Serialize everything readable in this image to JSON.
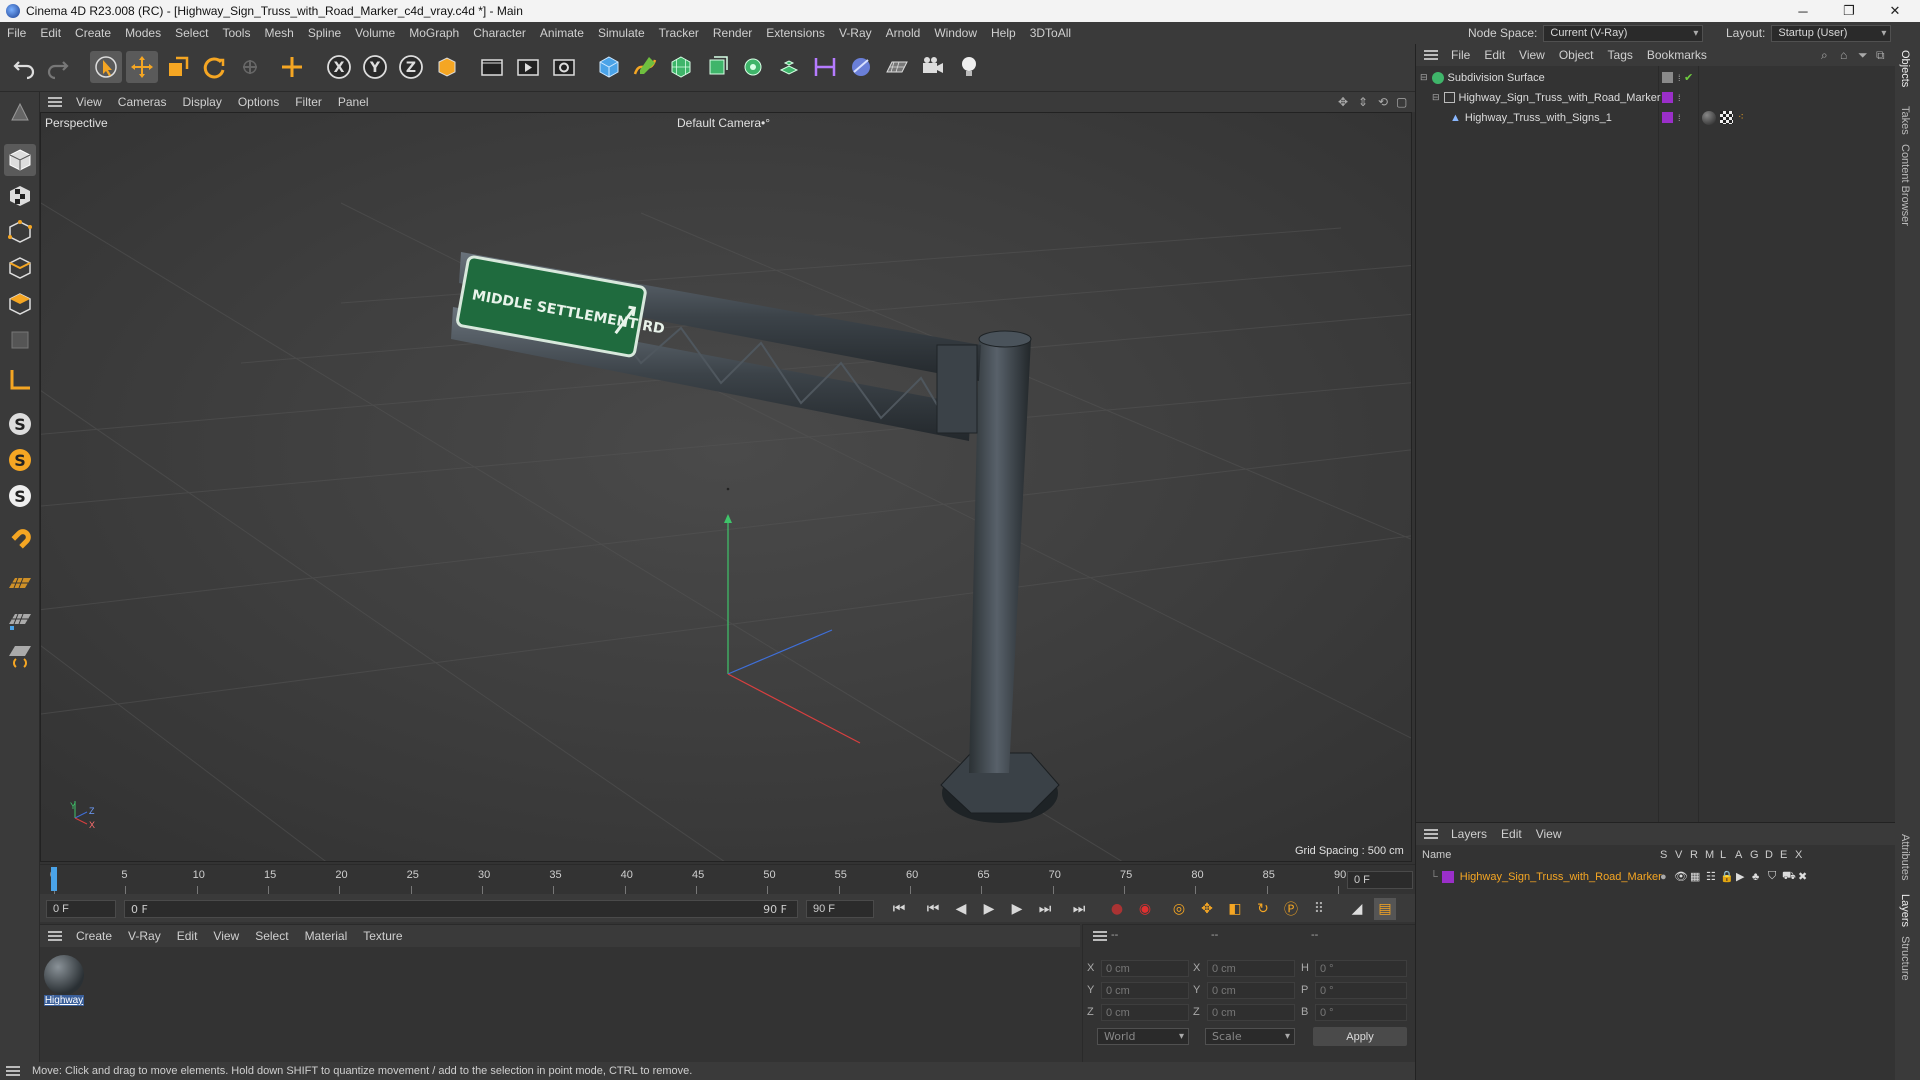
{
  "window": {
    "title": "Cinema 4D R23.008 (RC) - [Highway_Sign_Truss_with_Road_Marker_c4d_vray.c4d *] - Main",
    "minimize": "─",
    "maximize": "❐",
    "close": "✕"
  },
  "menubar": {
    "items": [
      "File",
      "Edit",
      "Create",
      "Modes",
      "Select",
      "Tools",
      "Mesh",
      "Spline",
      "Volume",
      "MoGraph",
      "Character",
      "Animate",
      "Simulate",
      "Tracker",
      "Render",
      "Extensions",
      "V-Ray",
      "Arnold",
      "Window",
      "Help",
      "3DToAll"
    ],
    "node_space_label": "Node Space:",
    "node_space_value": "Current (V-Ray)",
    "layout_label": "Layout:",
    "layout_value": "Startup (User)"
  },
  "viewport": {
    "menu": [
      "View",
      "Cameras",
      "Display",
      "Options",
      "Filter",
      "Panel"
    ],
    "view_name": "Perspective",
    "camera": "Default Camera",
    "camera_suffix": "•°",
    "grid_spacing": "Grid Spacing : 500 cm",
    "sign_text": "MIDDLE SETTLEMENT RD",
    "axis_y": "Y",
    "axis_z": "Z",
    "axis_x": "X"
  },
  "timeline": {
    "ticks": [
      "0",
      "5",
      "10",
      "15",
      "20",
      "25",
      "30",
      "35",
      "40",
      "45",
      "50",
      "55",
      "60",
      "65",
      "70",
      "75",
      "80",
      "85",
      "90"
    ],
    "current_frame": "0 F",
    "start_field": "0 F",
    "range_start": "0 F",
    "range_end": "90 F",
    "end_field": "90 F"
  },
  "material_panel": {
    "menu": [
      "Create",
      "V-Ray",
      "Edit",
      "View",
      "Select",
      "Material",
      "Texture"
    ],
    "material_name": "Highway"
  },
  "coordinates": {
    "headers": [
      "--",
      "--",
      "--"
    ],
    "pos_labels": [
      "X",
      "Y",
      "Z"
    ],
    "pos_values": [
      "0 cm",
      "0 cm",
      "0 cm"
    ],
    "size_labels": [
      "X",
      "Y",
      "Z"
    ],
    "size_values": [
      "0 cm",
      "0 cm",
      "0 cm"
    ],
    "rot_labels": [
      "H",
      "P",
      "B"
    ],
    "rot_values": [
      "0 °",
      "0 °",
      "0 °"
    ],
    "mode_world": "World",
    "mode_scale": "Scale",
    "apply": "Apply"
  },
  "status": {
    "text": "Move: Click and drag to move elements. Hold down SHIFT to quantize movement / add to the selection in point mode, CTRL to remove."
  },
  "object_manager": {
    "menu": [
      "File",
      "Edit",
      "View",
      "Object",
      "Tags",
      "Bookmarks"
    ],
    "objects": [
      {
        "name": "Subdivision Surface"
      },
      {
        "name": "Highway_Sign_Truss_with_Road_Marker"
      },
      {
        "name": "Highway_Truss_with_Signs_1"
      }
    ]
  },
  "layer_manager": {
    "menu": [
      "Layers",
      "Edit",
      "View"
    ],
    "name_header": "Name",
    "columns": [
      "S",
      "V",
      "R",
      "M",
      "L",
      "A",
      "G",
      "D",
      "E",
      "X"
    ],
    "layers": [
      {
        "name": "Highway_Sign_Truss_with_Road_Marker",
        "color": "#9a2fc9"
      }
    ]
  },
  "side_tabs": [
    "Objects",
    "Takes",
    "Content Browser",
    "Attributes",
    "Layers",
    "Structure"
  ],
  "colors": {
    "accent_orange": "#f5a623",
    "layer_purple": "#9a2fc9",
    "sign_green": "#1f6b3e",
    "record_red": "#e03030"
  }
}
